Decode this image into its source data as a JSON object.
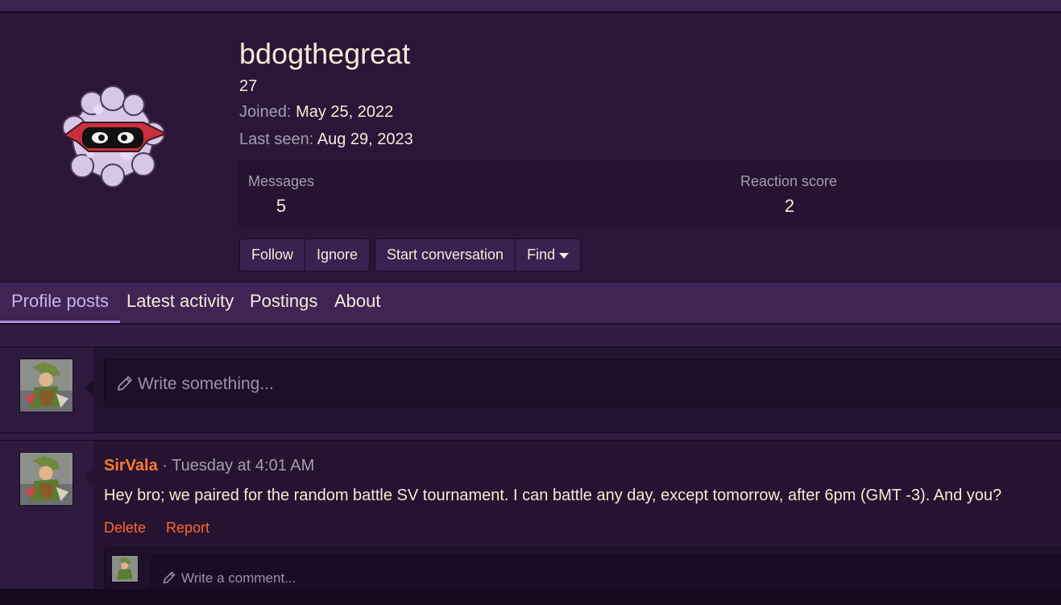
{
  "profile": {
    "username": "bdogthegreat",
    "title": "27",
    "joined_label": "Joined:",
    "joined_value": "May 25, 2022",
    "last_seen_label": "Last seen:",
    "last_seen_value": "Aug 29, 2023",
    "avatar_icon": "pokemon-sprite-avatar"
  },
  "stats": {
    "messages_label": "Messages",
    "messages_value": "5",
    "reaction_label": "Reaction score",
    "reaction_value": "2"
  },
  "actions": {
    "follow": "Follow",
    "ignore": "Ignore",
    "start_conversation": "Start conversation",
    "find": "Find"
  },
  "tabs": [
    {
      "label": "Profile posts",
      "active": true
    },
    {
      "label": "Latest activity",
      "active": false
    },
    {
      "label": "Postings",
      "active": false
    },
    {
      "label": "About",
      "active": false
    }
  ],
  "composer": {
    "placeholder": "Write something..."
  },
  "post": {
    "author": "SirVala",
    "separator": "·",
    "time": "Tuesday at 4:01 AM",
    "body": "Hey bro; we paired for the random battle SV tournament. I can battle any day, except tomorrow, after 6pm (GMT -3). And you?",
    "delete_label": "Delete",
    "report_label": "Report",
    "comment_placeholder": "Write a comment..."
  },
  "colors": {
    "accent": "#ff7a2f",
    "tab_active": "#c9b5ee",
    "header_bg": "#2a1638"
  }
}
